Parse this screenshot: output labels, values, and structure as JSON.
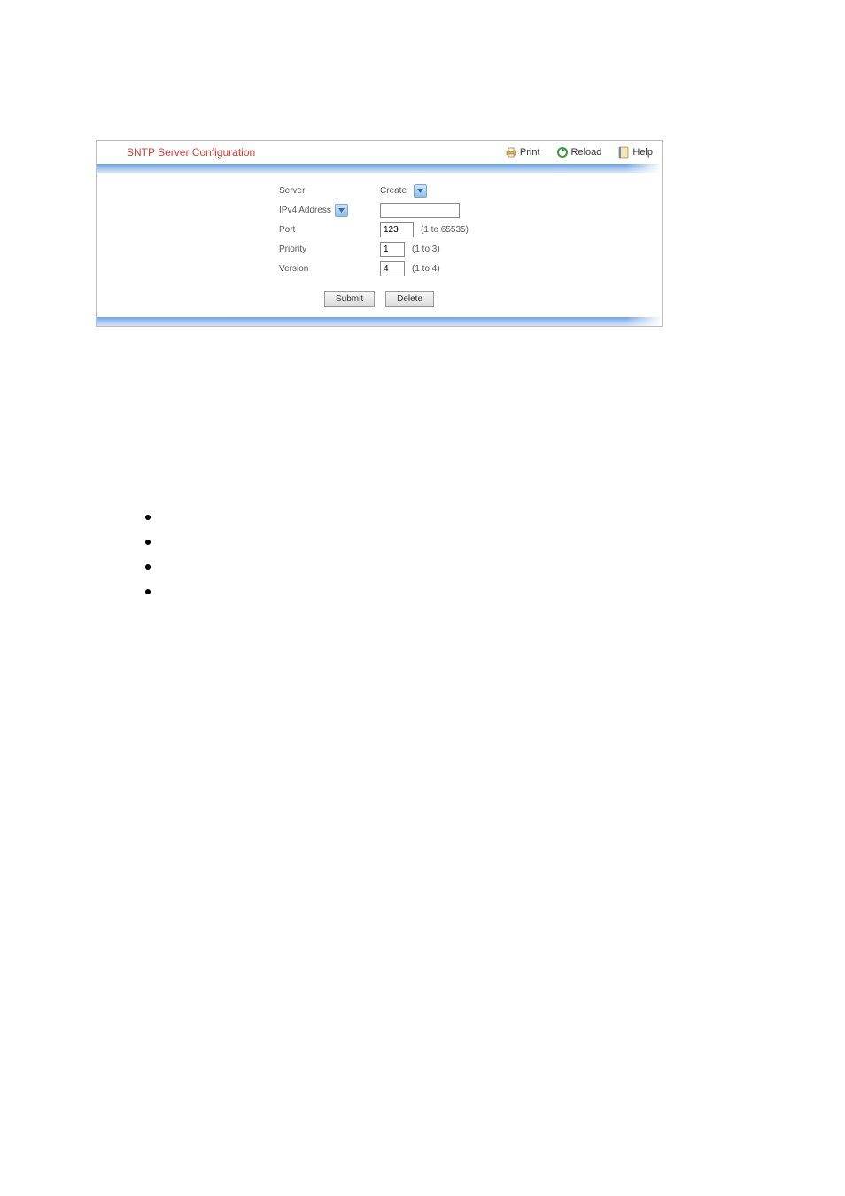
{
  "title": "SNTP Server Configuration",
  "actions": {
    "print": "Print",
    "reload": "Reload",
    "help": "Help"
  },
  "form": {
    "server_label": "Server",
    "server_value": "Create",
    "type_label": "IPv4 Address",
    "type_value": "",
    "port_label": "Port",
    "port_value": "123",
    "port_hint": "(1 to 65535)",
    "priority_label": "Priority",
    "priority_value": "1",
    "priority_hint": "(1 to 3)",
    "version_label": "Version",
    "version_value": "4",
    "version_hint": "(1 to 4)"
  },
  "buttons": {
    "submit": "Submit",
    "delete": "Delete"
  }
}
